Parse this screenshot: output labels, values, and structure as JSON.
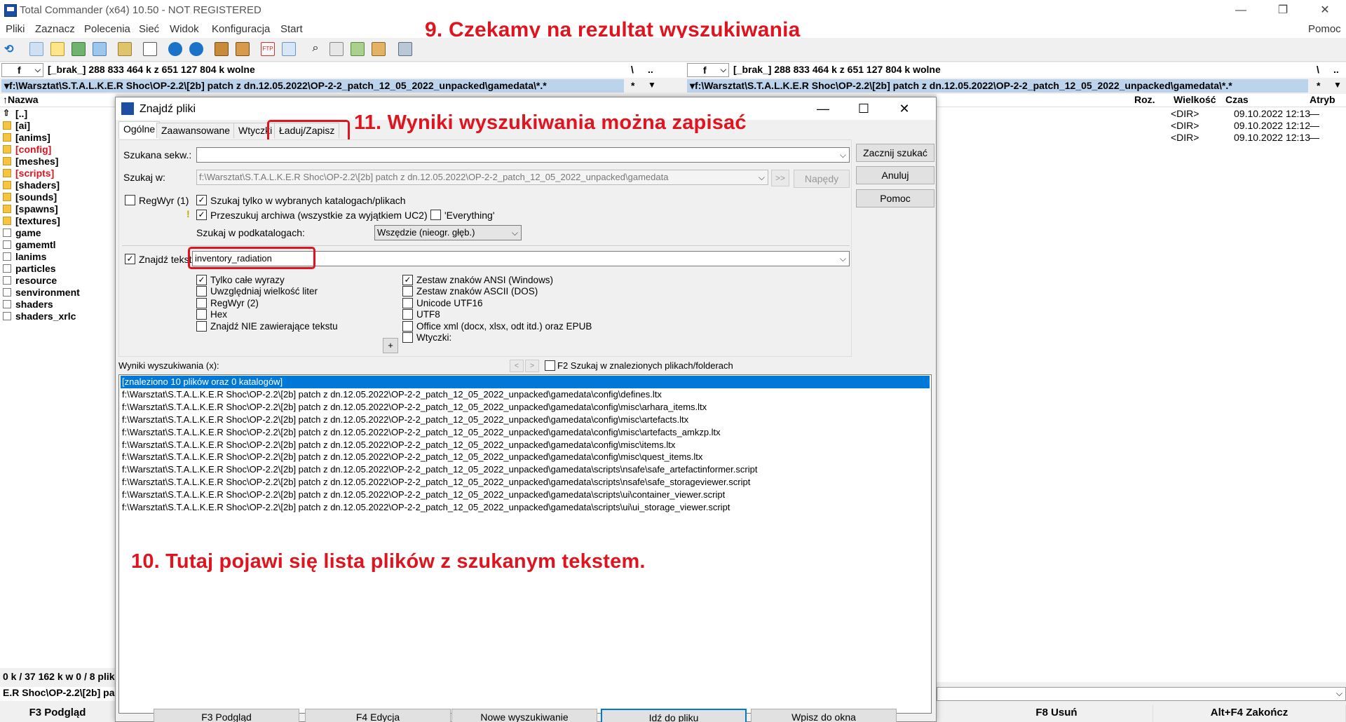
{
  "app": {
    "title": "Total Commander (x64) 10.50 - NOT REGISTERED",
    "window_controls": {
      "minimize": "—",
      "restore": "❐",
      "close": "✕"
    }
  },
  "menu": [
    "Pliki",
    "Zaznacz",
    "Polecenia",
    "Sieć",
    "Widok",
    "Konfiguracja",
    "Start"
  ],
  "menu_help": "Pomoc",
  "annotations": {
    "a9": "9. Czekamy na rezultat wyszukiwania",
    "a11": "11.  Wyniki wyszukiwania można zapisać",
    "a10": "10. Tutaj pojawi się lista plików z szukanym tekstem."
  },
  "left_panel": {
    "drive": "f",
    "drive_info": "[_brak_]  288 833 464 k z 651 127 804 k wolne",
    "path": "▾f:\\Warsztat\\S.T.A.L.K.E.R Shoc\\OP-2.2\\[2b] patch z dn.12.05.2022\\OP-2-2_patch_12_05_2022_unpacked\\gamedata\\*.*",
    "header_name": "↑Nazwa",
    "root_btn": "\\",
    "up_btn": "..",
    "star": "*",
    "items": [
      {
        "name": "[..]",
        "type": "up",
        "color": "normal"
      },
      {
        "name": "[ai]",
        "type": "folder",
        "color": "normal"
      },
      {
        "name": "[anims]",
        "type": "folder",
        "color": "normal"
      },
      {
        "name": "[config]",
        "type": "folder",
        "color": "red"
      },
      {
        "name": "[meshes]",
        "type": "folder",
        "color": "normal"
      },
      {
        "name": "[scripts]",
        "type": "folder",
        "color": "red"
      },
      {
        "name": "[shaders]",
        "type": "folder",
        "color": "normal"
      },
      {
        "name": "[sounds]",
        "type": "folder",
        "color": "normal"
      },
      {
        "name": "[spawns]",
        "type": "folder",
        "color": "normal"
      },
      {
        "name": "[textures]",
        "type": "folder",
        "color": "normal"
      },
      {
        "name": "game",
        "type": "file",
        "color": "normal"
      },
      {
        "name": "gamemtl",
        "type": "file",
        "color": "normal"
      },
      {
        "name": "lanims",
        "type": "file",
        "color": "normal"
      },
      {
        "name": "particles",
        "type": "file",
        "color": "normal"
      },
      {
        "name": "resource",
        "type": "file",
        "color": "normal"
      },
      {
        "name": "senvironment",
        "type": "file",
        "color": "normal"
      },
      {
        "name": "shaders",
        "type": "file",
        "color": "normal"
      },
      {
        "name": "shaders_xrlc",
        "type": "file",
        "color": "normal"
      }
    ],
    "status": "0 k / 37 162 k w 0 / 8 plik",
    "cmd_path": "E.R Shoc\\OP-2.2\\[2b] pa"
  },
  "right_panel": {
    "drive": "f",
    "drive_info": "[_brak_]  288 833 464 k z 651 127 804 k wolne",
    "path": "▾f:\\Warsztat\\S.T.A.L.K.E.R Shoc\\OP-2.2\\[2b] patch z dn.12.05.2022\\OP-2-2_patch_12_05_2022_unpacked\\gamedata\\*.*",
    "root_btn": "\\",
    "up_btn": "..",
    "star": "*",
    "headers": {
      "ext": "Roz.",
      "size": "Wielkość",
      "date": "Czas",
      "attr": "Atryb"
    },
    "rows": [
      {
        "size": "<DIR>",
        "date": "09.10.2022 12:13",
        "attr": "—"
      },
      {
        "size": "<DIR>",
        "date": "09.10.2022 12:12",
        "attr": "—"
      },
      {
        "size": "<DIR>",
        "date": "09.10.2022 12:13",
        "attr": "—"
      }
    ]
  },
  "fkeys": [
    "F3 Podgląd",
    "F8 Usuń",
    "Alt+F4 Zakończ"
  ],
  "dialog": {
    "title": "Znajdź pliki",
    "controls": {
      "minimize": "—",
      "maximize": "☐",
      "close": "✕"
    },
    "tabs": [
      "Ogólne",
      "Zaawansowane",
      "Wtyczki",
      "Ładuj/Zapisz"
    ],
    "search_for_label": "Szukana sekw.:",
    "search_for_value": "",
    "search_in_label": "Szukaj w:",
    "search_in_value": "f:\\Warsztat\\S.T.A.L.K.E.R Shoc\\OP-2.2\\[2b] patch z dn.12.05.2022\\OP-2-2_patch_12_05_2022_unpacked\\gamedata",
    "browse_btn": ">>",
    "drives_btn": "Napędy",
    "regex1": "RegWyr (1)",
    "only_selected": "Szukaj tylko w wybranych katalogach/plikach",
    "archives": "Przeszukuj archiwa (wszystkie za wyjątkiem UC2)",
    "everything": "'Everything'",
    "subdirs_label": "Szukaj w podkatalogach:",
    "subdirs_value": "Wszędzie (nieogr. głęb.)",
    "find_text_label": "Znajdź tekst:",
    "find_text_value": "inventory_radiation",
    "opts_left": [
      {
        "label": "Tylko całe wyrazy",
        "checked": true
      },
      {
        "label": "Uwzględniaj wielkość liter",
        "checked": false
      },
      {
        "label": "RegWyr (2)",
        "checked": false
      },
      {
        "label": "Hex",
        "checked": false
      },
      {
        "label": "Znajdź NIE zawierające tekstu",
        "checked": false
      }
    ],
    "opts_right": [
      {
        "label": "Zestaw znaków ANSI (Windows)",
        "checked": true
      },
      {
        "label": "Zestaw znaków ASCII (DOS)",
        "checked": false
      },
      {
        "label": "Unicode UTF16",
        "checked": false
      },
      {
        "label": "UTF8",
        "checked": false
      },
      {
        "label": "Office xml (docx, xlsx, odt itd.) oraz EPUB",
        "checked": false
      },
      {
        "label": "Wtyczki:",
        "checked": false
      }
    ],
    "plus_btn": "+",
    "buttons": {
      "start": "Zacznij szukać",
      "cancel": "Anuluj",
      "help": "Pomoc"
    },
    "results_label": "Wyniki wyszukiwania (x):",
    "nav_prev": "<",
    "nav_next": ">",
    "f2_label": "F2 Szukaj w znalezionych plikach/folderach",
    "results": [
      "[znaleziono 10 plików oraz 0 katalogów]",
      "f:\\Warsztat\\S.T.A.L.K.E.R Shoc\\OP-2.2\\[2b] patch z dn.12.05.2022\\OP-2-2_patch_12_05_2022_unpacked\\gamedata\\config\\defines.ltx",
      "f:\\Warsztat\\S.T.A.L.K.E.R Shoc\\OP-2.2\\[2b] patch z dn.12.05.2022\\OP-2-2_patch_12_05_2022_unpacked\\gamedata\\config\\misc\\arhara_items.ltx",
      "f:\\Warsztat\\S.T.A.L.K.E.R Shoc\\OP-2.2\\[2b] patch z dn.12.05.2022\\OP-2-2_patch_12_05_2022_unpacked\\gamedata\\config\\misc\\artefacts.ltx",
      "f:\\Warsztat\\S.T.A.L.K.E.R Shoc\\OP-2.2\\[2b] patch z dn.12.05.2022\\OP-2-2_patch_12_05_2022_unpacked\\gamedata\\config\\misc\\artefacts_amkzp.ltx",
      "f:\\Warsztat\\S.T.A.L.K.E.R Shoc\\OP-2.2\\[2b] patch z dn.12.05.2022\\OP-2-2_patch_12_05_2022_unpacked\\gamedata\\config\\misc\\items.ltx",
      "f:\\Warsztat\\S.T.A.L.K.E.R Shoc\\OP-2.2\\[2b] patch z dn.12.05.2022\\OP-2-2_patch_12_05_2022_unpacked\\gamedata\\config\\misc\\quest_items.ltx",
      "f:\\Warsztat\\S.T.A.L.K.E.R Shoc\\OP-2.2\\[2b] patch z dn.12.05.2022\\OP-2-2_patch_12_05_2022_unpacked\\gamedata\\scripts\\nsafe\\safe_artefactinformer.script",
      "f:\\Warsztat\\S.T.A.L.K.E.R Shoc\\OP-2.2\\[2b] patch z dn.12.05.2022\\OP-2-2_patch_12_05_2022_unpacked\\gamedata\\scripts\\nsafe\\safe_storageviewer.script",
      "f:\\Warsztat\\S.T.A.L.K.E.R Shoc\\OP-2.2\\[2b] patch z dn.12.05.2022\\OP-2-2_patch_12_05_2022_unpacked\\gamedata\\scripts\\ui\\container_viewer.script",
      "f:\\Warsztat\\S.T.A.L.K.E.R Shoc\\OP-2.2\\[2b] patch z dn.12.05.2022\\OP-2-2_patch_12_05_2022_unpacked\\gamedata\\scripts\\ui\\ui_storage_viewer.script"
    ],
    "bottom_buttons": [
      "F3 Podgląd",
      "F4 Edycja",
      "Nowe wyszukiwanie",
      "Idź do pliku",
      "Wpisz do okna"
    ]
  },
  "colors": {
    "annotation": "#e0141e",
    "selection": "#0078d7",
    "path_bar": "#bcd3ec"
  }
}
